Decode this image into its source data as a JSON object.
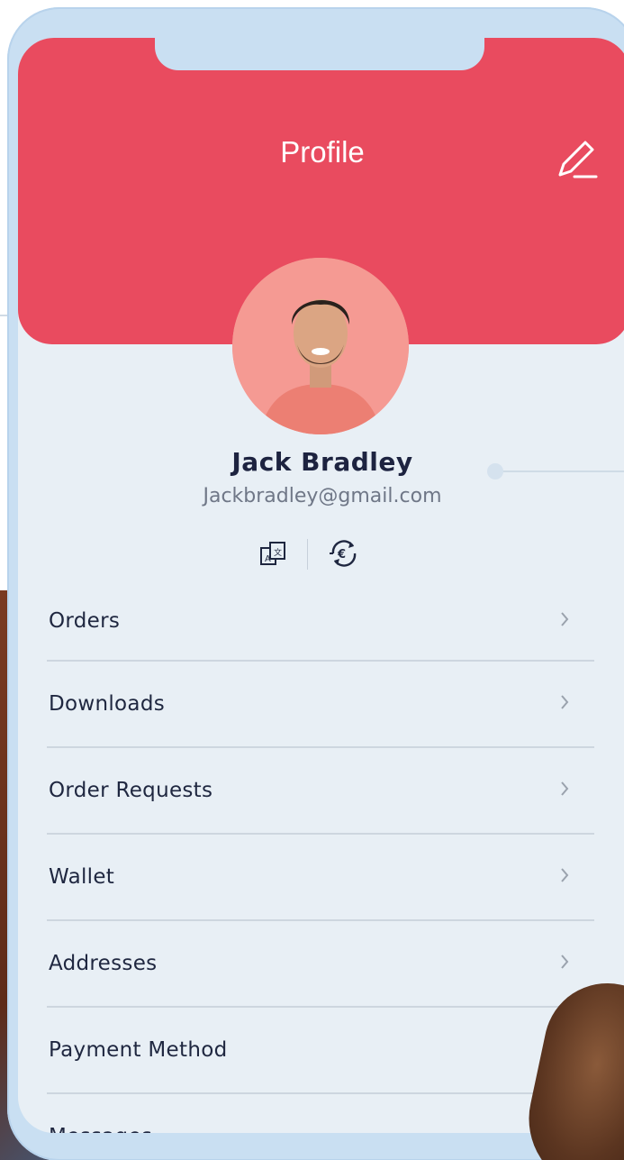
{
  "header": {
    "title": "Profile",
    "edit_icon": "pencil-icon"
  },
  "profile": {
    "name": "Jack Bradley",
    "email": "Jackbradley@gmail.com",
    "actions": [
      {
        "icon": "language-translate-icon"
      },
      {
        "icon": "currency-euro-exchange-icon"
      }
    ]
  },
  "menu": {
    "items": [
      {
        "label": "Orders"
      },
      {
        "label": "Downloads"
      },
      {
        "label": "Order Requests"
      },
      {
        "label": "Wallet"
      },
      {
        "label": "Addresses"
      },
      {
        "label": "Payment Method"
      },
      {
        "label": "Messages"
      }
    ],
    "chevron_icon": "chevron-right-icon"
  },
  "colors": {
    "header": "#e94b5f",
    "screen_bg": "#e8eff5",
    "phone_frame": "#c9dff2",
    "text_primary": "#1d2340",
    "text_secondary": "#6f7787"
  }
}
